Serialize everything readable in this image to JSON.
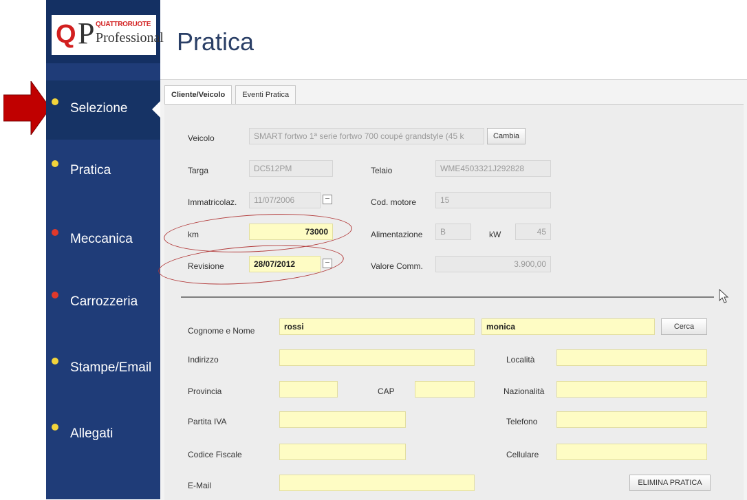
{
  "sidebar": {
    "logo": {
      "q": "Q",
      "p": "P",
      "brand": "QUATTRORUOTE",
      "sub": "Professional"
    },
    "items": [
      {
        "label": "Selezione",
        "dot": "#f2d43b",
        "active": true
      },
      {
        "label": "Pratica",
        "dot": "#f2d43b"
      },
      {
        "label": "Meccanica",
        "dot": "#e0392b"
      },
      {
        "label": "Carrozzeria",
        "dot": "#e0392b"
      },
      {
        "label": "Stampe/Email",
        "dot": "#f2d43b"
      },
      {
        "label": "Allegati",
        "dot": "#f2d43b"
      }
    ]
  },
  "page": {
    "title": "Pratica"
  },
  "tabs": [
    {
      "label": "Cliente/Veicolo"
    },
    {
      "label": "Eventi Pratica"
    }
  ],
  "vehicle": {
    "veicolo_label": "Veicolo",
    "veicolo_value": "SMART fortwo 1ª serie fortwo 700 coupé grandstyle (45 k",
    "cambia": "Cambia",
    "targa_label": "Targa",
    "targa_value": "DC512PM",
    "telaio_label": "Telaio",
    "telaio_value": "WME4503321J292828",
    "immatricolaz_label": "Immatricolaz.",
    "immatricolaz_value": "11/07/2006",
    "cod_motore_label": "Cod. motore",
    "cod_motore_value": "15",
    "km_label": "km",
    "km_value": "73000",
    "alimentazione_label": "Alimentazione",
    "alimentazione_value": "B",
    "kw_label": "kW",
    "kw_value": "45",
    "revisione_label": "Revisione",
    "revisione_value": "28/07/2012",
    "valore_label": "Valore Comm.",
    "valore_value": "3.900,00"
  },
  "client": {
    "cognome_label": "Cognome e Nome",
    "cognome_value": "rossi",
    "nome_value": "monica",
    "cerca": "Cerca",
    "indirizzo_label": "Indirizzo",
    "indirizzo_value": "",
    "localita_label": "Località",
    "localita_value": "",
    "provincia_label": "Provincia",
    "provincia_value": "",
    "cap_label": "CAP",
    "cap_value": "",
    "nazionalita_label": "Nazionalità",
    "nazionalita_value": "",
    "piva_label": "Partita IVA",
    "piva_value": "",
    "telefono_label": "Telefono",
    "telefono_value": "",
    "cf_label": "Codice Fiscale",
    "cf_value": "",
    "cellulare_label": "Cellulare",
    "cellulare_value": "",
    "email_label": "E-Mail",
    "email_value": "",
    "elimina": "ELIMINA PRATICA"
  },
  "colors": {
    "sidebar": "#1f3c78",
    "field_yellow": "#fefcc4",
    "annotation": "#b23a3a"
  }
}
